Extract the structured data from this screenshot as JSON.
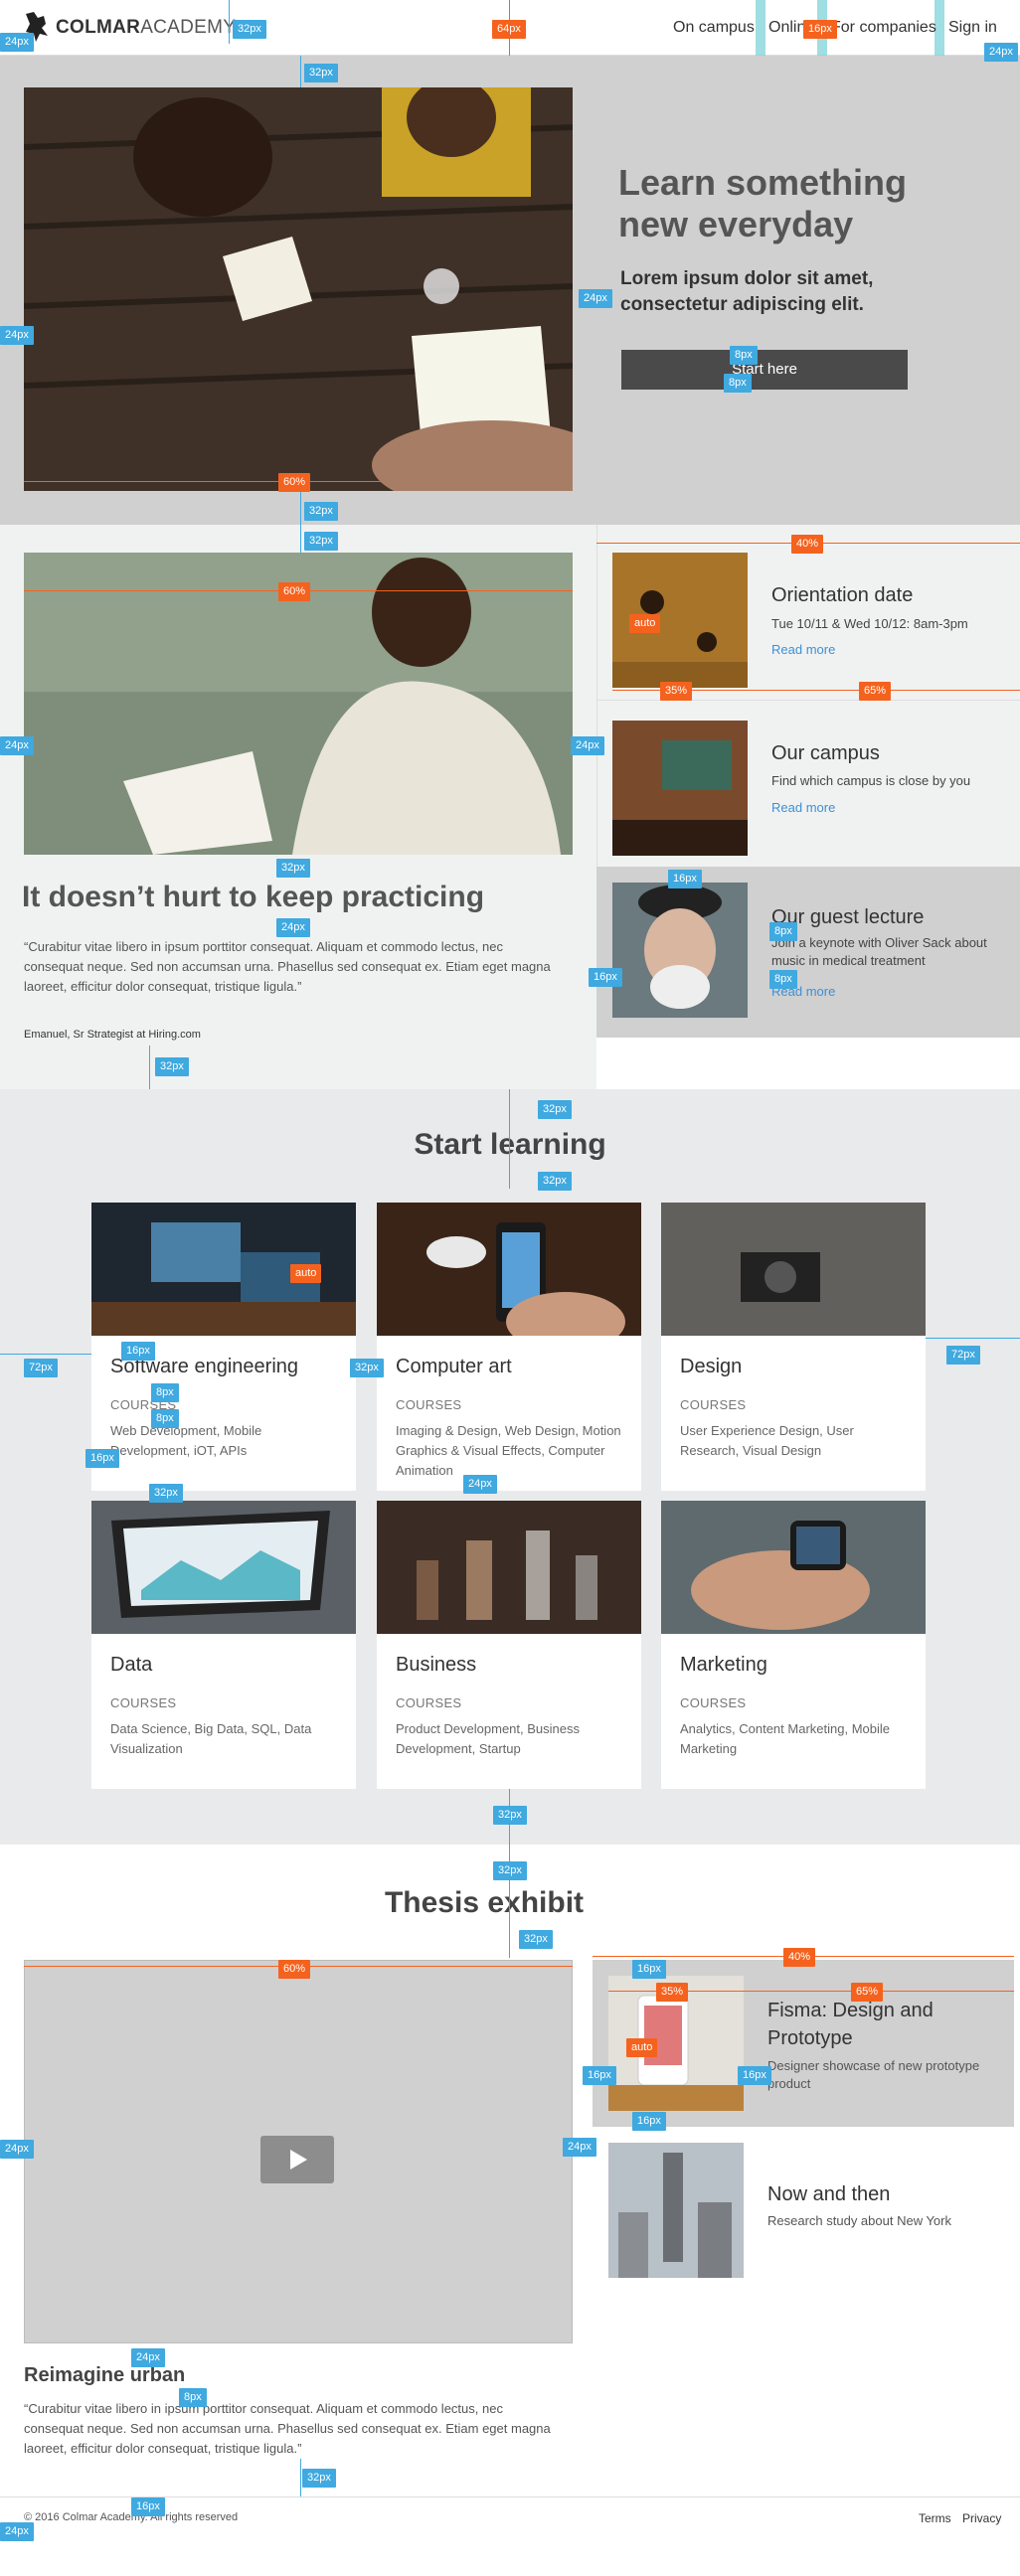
{
  "header": {
    "logo_bold": "COLMAR",
    "logo_light": "ACADEMY",
    "logo_icon": "lion-crest-icon",
    "nav": [
      "On campus",
      "Online",
      "For companies",
      "Sign in"
    ]
  },
  "hero": {
    "title": "Learn something new everyday",
    "subtitle": "Lorem ipsum dolor sit amet, consectetur adipiscing elit.",
    "button": "Start here"
  },
  "practice": {
    "title": "It doesn’t hurt to keep practicing",
    "quote": "“Curabitur vitae libero in ipsum porttitor consequat. Aliquam et commodo lectus, nec consequat neque. Sed non accumsan urna. Phasellus sed consequat ex. Etiam eget magna laoreet, efficitur dolor consequat, tristique ligula.”",
    "author": "Emanuel, Sr Strategist at Hiring.com"
  },
  "events": [
    {
      "title": "Orientation date",
      "desc": "Tue 10/11 & Wed 10/12: 8am-3pm",
      "link": "Read more"
    },
    {
      "title": "Our campus",
      "desc": "Find which campus is close by you",
      "link": "Read more"
    },
    {
      "title": "Our guest lecture",
      "desc": "Join a keynote with Oliver Sack about music in medical treatment",
      "link": "Read more"
    }
  ],
  "learning": {
    "title": "Start learning",
    "cards": [
      {
        "title": "Software engineering",
        "kicker": "COURSES",
        "desc": "Web Development, Mobile Development, iOT, APIs"
      },
      {
        "title": "Computer art",
        "kicker": "COURSES",
        "desc": "Imaging & Design, Web Design, Motion Graphics & Visual Effects, Computer Animation"
      },
      {
        "title": "Design",
        "kicker": "COURSES",
        "desc": "User Experience Design, User Research, Visual Design"
      },
      {
        "title": "Data",
        "kicker": "COURSES",
        "desc": "Data Science, Big Data, SQL, Data Visualization"
      },
      {
        "title": "Business",
        "kicker": "COURSES",
        "desc": "Product Development, Business Development, Startup"
      },
      {
        "title": "Marketing",
        "kicker": "COURSES",
        "desc": "Analytics, Content Marketing, Mobile Marketing"
      }
    ]
  },
  "thesis": {
    "title": "Thesis exhibit",
    "video_caption": "Reimagine urban",
    "quote": "“Curabitur vitae libero in ipsum porttitor consequat. Aliquam et commodo lectus, nec consequat neque. Sed non accumsan urna. Phasellus sed consequat ex. Etiam eget magna laoreet, efficitur dolor consequat, tristique ligula.”",
    "projects": [
      {
        "title": "Fisma: Design and Prototype",
        "desc": "Designer showcase of new prototype product"
      },
      {
        "title": "Now and then",
        "desc": "Research study about New York"
      }
    ]
  },
  "footer": {
    "copyright": "© 2016 Colmar Academy. All rights reserved",
    "links": [
      "Terms",
      "Privacy"
    ]
  },
  "specs": {
    "s24": "24px",
    "s32": "32px",
    "s64": "64px",
    "s16": "16px",
    "s8": "8px",
    "s72": "72px",
    "p60": "60%",
    "p40": "40%",
    "p35": "35%",
    "p65": "65%",
    "auto": "auto"
  },
  "colors": {
    "spec_blue": "#3fa9e0",
    "spec_orange": "#f5621e",
    "link_blue": "#3d8fd6",
    "hero_bg": "#d0d0d0",
    "button_bg": "#4a4a4a"
  }
}
